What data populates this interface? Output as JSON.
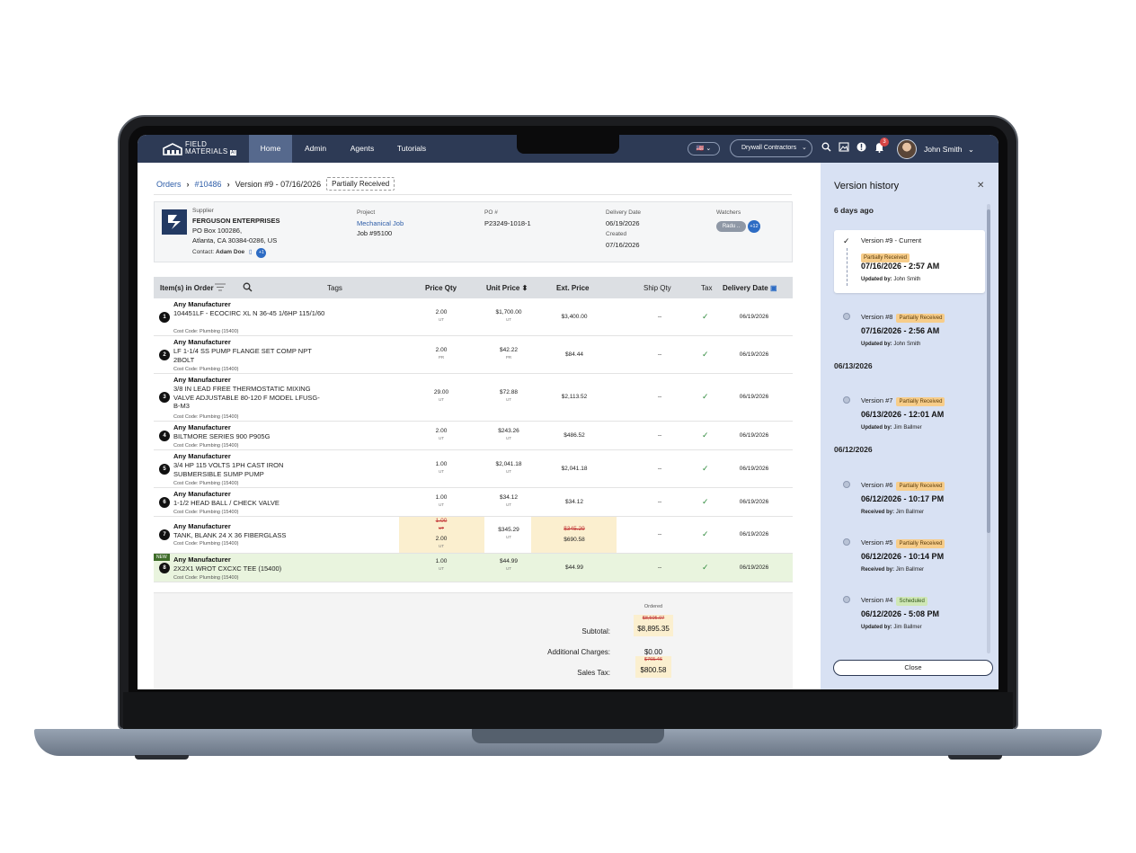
{
  "nav": {
    "logo_text_1": "FIELD",
    "logo_text_2": "MATERIALS",
    "logo_badge": "AI",
    "tabs": [
      "Home",
      "Admin",
      "Agents",
      "Tutorials"
    ],
    "flag": "🇺🇸",
    "org": "Drywall Contractors",
    "notifications_count": "3",
    "user": "John Smith"
  },
  "breadcrumb": {
    "orders": "Orders",
    "order_no": "#10486",
    "version": "Version #9 - 07/16/2026",
    "status": "Partially Received"
  },
  "supplier": {
    "label": "Supplier",
    "name": "FERGUSON ENTERPRISES",
    "address1": "PO Box 100286,",
    "address2": "Atlanta, CA 30384-0286, US",
    "contact_label": "Contact:",
    "contact": "Adam Doe",
    "contact_extra": "+1"
  },
  "project": {
    "label": "Project",
    "name": "Mechanical Job",
    "job": "Job #95100"
  },
  "po": {
    "label": "PO #",
    "value": "P23249-1018-1"
  },
  "dates": {
    "delivery_label": "Delivery Date",
    "delivery": "06/19/2026",
    "created_label": "Created",
    "created": "07/16/2026"
  },
  "watchers": {
    "label": "Watchers",
    "name": "Radu ..",
    "extra": "+12"
  },
  "table": {
    "headers": {
      "items": "Item(s) in Order",
      "tags": "Tags",
      "price_qty": "Price Qty",
      "unit_price": "Unit Price",
      "ext_price": "Ext. Price",
      "ship_qty": "Ship Qty",
      "tax": "Tax",
      "delivery_date": "Delivery Date"
    },
    "rows": [
      {
        "n": "1",
        "mfr": "Any Manufacturer",
        "desc": "104451LF - ECOCIRC XL N 36-45 1/6HP 115/1/60",
        "cost": "Cost Code: Plumbing (15400)",
        "qty": "2.00",
        "qty_unit": "UT",
        "price": "$1,700.00",
        "price_unit": "UT",
        "ext": "$3,400.00",
        "ship": "--",
        "date": "06/19/2026"
      },
      {
        "n": "2",
        "mfr": "Any Manufacturer",
        "desc": "LF 1-1/4 SS PUMP FLANGE SET COMP NPT 2BOLT",
        "cost": "Cost Code: Plumbing (15400)",
        "qty": "2.00",
        "qty_unit": "PR",
        "price": "$42.22",
        "price_unit": "PR",
        "ext": "$84.44",
        "ship": "--",
        "date": "06/19/2026"
      },
      {
        "n": "3",
        "mfr": "Any Manufacturer",
        "desc": "3/8 IN LEAD FREE THERMOSTATIC MIXING VALVE ADJUSTABLE 80-120 F MODEL LFUSG-B-M3",
        "cost": "Cost Code: Plumbing (15400)",
        "qty": "29.00",
        "qty_unit": "UT",
        "price": "$72.88",
        "price_unit": "UT",
        "ext": "$2,113.52",
        "ship": "--",
        "date": "06/19/2026"
      },
      {
        "n": "4",
        "mfr": "Any Manufacturer",
        "desc": "BILTMORE SERIES 900 P905G",
        "cost": "Cost Code: Plumbing (15400)",
        "qty": "2.00",
        "qty_unit": "UT",
        "price": "$243.26",
        "price_unit": "UT",
        "ext": "$486.52",
        "ship": "--",
        "date": "06/19/2026"
      },
      {
        "n": "5",
        "mfr": "Any Manufacturer",
        "desc": "3/4 HP 115 VOLTS 1PH CAST IRON SUBMERSIBLE SUMP PUMP",
        "cost": "Cost Code: Plumbing (15400)",
        "qty": "1.00",
        "qty_unit": "UT",
        "price": "$2,041.18",
        "price_unit": "UT",
        "ext": "$2,041.18",
        "ship": "--",
        "date": "06/19/2026"
      },
      {
        "n": "6",
        "mfr": "Any Manufacturer",
        "desc": "1-1/2 HEAD BALL / CHECK VALVE",
        "cost": "Cost Code: Plumbing (15400)",
        "qty": "1.00",
        "qty_unit": "UT",
        "price": "$34.12",
        "price_unit": "UT",
        "ext": "$34.12",
        "ship": "--",
        "date": "06/19/2026"
      },
      {
        "n": "7",
        "mfr": "Any Manufacturer",
        "desc": "TANK, BLANK 24 X 36 FIBERGLASS",
        "cost": "Cost Code: Plumbing (15400)",
        "qty_old": "1.00",
        "qty_old_unit": "UT",
        "qty": "2.00",
        "qty_unit": "UT",
        "price": "$345.29",
        "price_unit": "UT",
        "ext_old": "$345.29",
        "ext": "$690.58",
        "ship": "--",
        "date": "06/19/2026"
      },
      {
        "n": "8",
        "new_tag": "NEW",
        "mfr": "Any Manufacturer",
        "desc": "2X2X1 WROT CXCXC TEE (15400)",
        "cost": "Cost Code: Plumbing (15400)",
        "qty": "1.00",
        "qty_unit": "UT",
        "price": "$44.99",
        "price_unit": "UT",
        "ext": "$44.99",
        "ship": "--",
        "date": "06/19/2026"
      }
    ]
  },
  "totals": {
    "ordered_label": "Ordered",
    "subtotal_label": "Subtotal:",
    "subtotal_old": "$8,505.07",
    "subtotal": "$8,895.35",
    "charges_label": "Additional Charges:",
    "charges": "$0.00",
    "tax_label": "Sales Tax:",
    "tax_old": "$765.46",
    "tax": "$800.58"
  },
  "version_panel": {
    "title": "Version history",
    "groups": [
      "6 days ago",
      "06/13/2026",
      "06/12/2026"
    ],
    "versions": [
      {
        "label": "Version #9 - Current",
        "status": "Partially Received",
        "time": "07/16/2026 - 2:57 AM",
        "by_label": "Updated by:",
        "by": "John Smith"
      },
      {
        "label": "Version #8",
        "status": "Partially Received",
        "time": "07/16/2026 - 2:56 AM",
        "by_label": "Updated by:",
        "by": "John Smith"
      },
      {
        "label": "Version #7",
        "status": "Partially Received",
        "time": "06/13/2026 - 12:01 AM",
        "by_label": "Updated by:",
        "by": "Jim Ballmer"
      },
      {
        "label": "Version #6",
        "status": "Partially Received",
        "time": "06/12/2026 - 10:17 PM",
        "by_label": "Received by:",
        "by": "Jim Ballmer"
      },
      {
        "label": "Version #5",
        "status": "Partially Received",
        "time": "06/12/2026 - 10:14 PM",
        "by_label": "Received by:",
        "by": "Jim Ballmer"
      },
      {
        "label": "Version #4",
        "status": "Scheduled",
        "time": "06/12/2026 - 5:08 PM",
        "by_label": "Updated by:",
        "by": "Jim Ballmer"
      }
    ],
    "close_label": "Close"
  },
  "colors": {
    "navbar": "#2d3a55",
    "panel": "#d8e1f3",
    "highlight": "#fbefcf",
    "new_row": "#e9f4de",
    "accent": "#2d5da8"
  }
}
